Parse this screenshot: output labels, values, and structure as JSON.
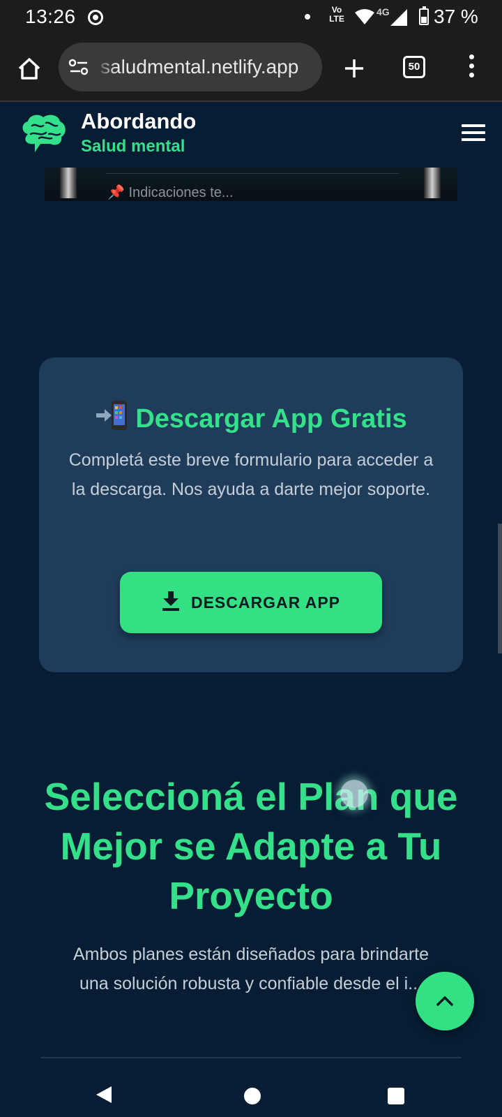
{
  "status_bar": {
    "time": "13:26",
    "volte": "Vo LTE",
    "network": "4G",
    "battery": "37 %"
  },
  "browser": {
    "url": "saludmental.netlify.app",
    "tab_count": "50"
  },
  "header": {
    "title": "Abordando",
    "subtitle": "Salud mental"
  },
  "fragment": {
    "text": "📌 Indicaciones te..."
  },
  "download_card": {
    "title": "Descargar App Gratis",
    "description": "Completá este breve formulario para acceder a la descarga. Nos ayuda a darte mejor soporte.",
    "button_label": "DESCARGAR APP"
  },
  "plans": {
    "title": "Seleccioná el Plan que Mejor se Adapte a Tu Proyecto",
    "description_line1": "Ambos planes están diseñados para brindarte",
    "description_line2": "una solución robusta y confiable desde el i..."
  },
  "colors": {
    "background": "#061d33",
    "card": "#1f3d5b",
    "accent": "#34e18a",
    "chrome": "#1c1c1c"
  },
  "icons": [
    "record-icon",
    "wifi-icon",
    "signal-icon",
    "battery-icon",
    "home-icon",
    "site-settings-icon",
    "plus-icon",
    "tabs-icon",
    "more-vert-icon",
    "brain-logo-icon",
    "hamburger-icon",
    "phone-arrow-icon",
    "download-icon",
    "chevron-up-icon",
    "back-icon",
    "nav-home-icon",
    "recents-icon"
  ]
}
